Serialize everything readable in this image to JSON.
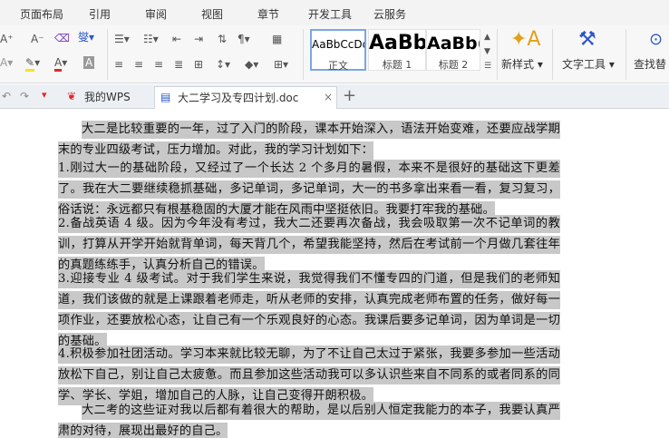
{
  "menu": [
    "页面布局",
    "引用",
    "审阅",
    "视图",
    "章节",
    "开发工具",
    "云服务"
  ],
  "ribbon": {
    "styles": [
      {
        "sample": "AaBbCcDd",
        "label": "正文"
      },
      {
        "sample": "AaBb",
        "label": "标题 1"
      },
      {
        "sample": "AaBb(",
        "label": "标题 2"
      }
    ],
    "new_style": "新样式",
    "text_tools": "文字工具",
    "find_replace": "查找替"
  },
  "tabs": {
    "home": "我的WPS",
    "doc": "大二学习及专四计划.doc"
  },
  "document": {
    "paragraphs": [
      "大二是比较重要的一年，过了入门的阶段，课本开始深入，语法开始变难，还要应战学期末的专业四级考试，压力增加。对此，我的学习计划如下：",
      "1.刚过大一的基础阶段，又经过了一个长达 2 个多月的暑假，本来不是很好的基础这下更差了。我在大二要继续稳抓基础，多记单词，多记单词，大一的书多拿出来看一看，复习复习，俗话说：永远都只有根基稳固的大厦才能在风雨中坚挺依旧。我要打牢我的基础。",
      "2.备战英语 4 级。因为今年没有考过，我大二还要再次备战，我会吸取第一次不记单词的教训，打算从开学开始就背单词，每天背几个，希望我能坚持，然后在考试前一个月做几套往年的真题练练手，认真分析自己的错误。",
      "3.迎接专业 4 级考试。对于我们学生来说，我觉得我们不懂专四的门道，但是我们的老师知道，我们该做的就是上课跟着老师走，听从老师的安排，认真完成老师布置的任务，做好每一项作业，还要放松心态，让自己有一个乐观良好的心态。我课后要多记单词，因为单词是一切的基础。",
      "4.积极参加社团活动。学习本来就比较无聊，为了不让自己太过于紧张，我要多参加一些活动放松下自己，别让自己太疲惫。而且参加这些活动我可以多认识些来自不同系的或者同系的同学、学长、学姐，增加自己的人脉，让自己变得开朗积极。",
      "大二考的这些证对我以后都有着很大的帮助，是以后别人恒定我能力的本子，我要认真严肃的对待，展现出最好的自己。"
    ]
  },
  "colors": {
    "menubar_bg": "#f3f3f3",
    "ribbon_bg": "#f7f7f7",
    "selection": "#c8c8c8",
    "accent_red": "#e0282a",
    "accent_blue": "#2a57c8",
    "highlight_yellow": "#f5e12a"
  }
}
